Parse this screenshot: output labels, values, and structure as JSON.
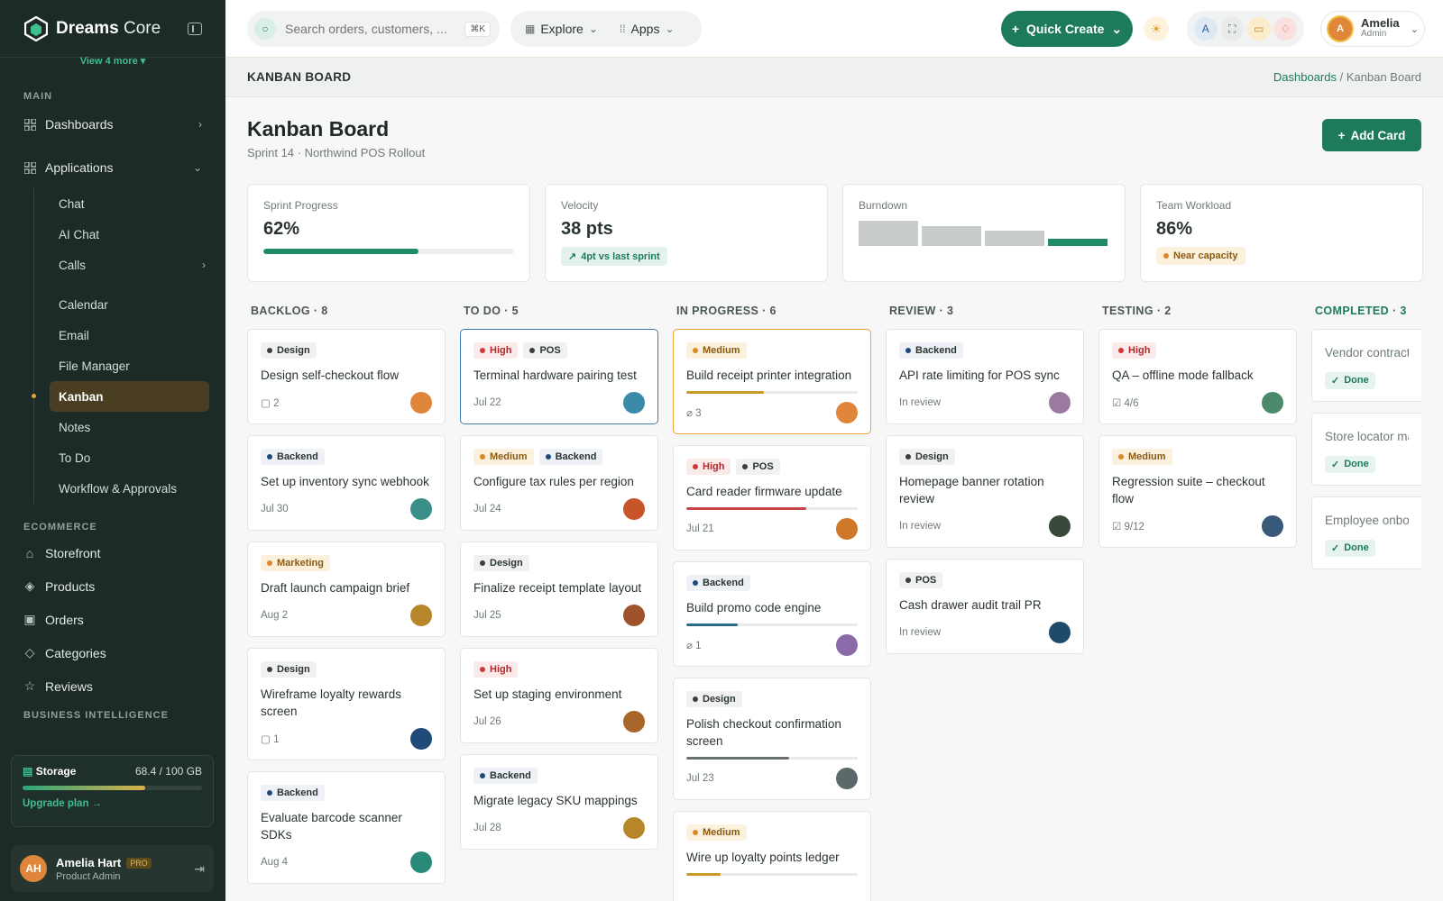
{
  "sidebar": {
    "brand_bold": "Dreams",
    "brand_light": "Core",
    "view_more": "View 4 more",
    "main_label": "MAIN",
    "dashboards": "Dashboards",
    "applications": "Applications",
    "apps": [
      "Chat",
      "AI Chat",
      "Calls",
      "Calendar",
      "Email",
      "File Manager",
      "Kanban",
      "Notes",
      "To Do",
      "Workflow & Approvals"
    ],
    "ecommerce_label": "ECOMMERCE",
    "ecommerce": [
      "Storefront",
      "Products",
      "Orders",
      "Categories",
      "Reviews"
    ],
    "bi_label": "BUSINESS INTELLIGENCE",
    "storage": {
      "label": "Storage",
      "value": "68.4 / 100 GB",
      "fraction": 0.684,
      "upgrade": "Upgrade plan →"
    },
    "user": {
      "name": "Amelia Hart",
      "badge": "PRO",
      "role": "Product Admin",
      "initials": "AH"
    }
  },
  "topbar": {
    "search_placeholder": "Search orders, customers, ...",
    "search_kbd": "⌘K",
    "explore": "Explore",
    "apps": "Apps",
    "quick_create": "Quick Create",
    "account_name": "Amelia",
    "account_role": "Admin",
    "account_initials": "A"
  },
  "page": {
    "header": "KANBAN BOARD",
    "breadcrumb_link": "Dashboards",
    "breadcrumb_sep": "/",
    "breadcrumb_current": "Kanban Board",
    "title": "Kanban Board",
    "subtitle": "Sprint 14 · Northwind POS Rollout",
    "add_card": "Add Card"
  },
  "stats": {
    "progress": {
      "label": "Sprint Progress",
      "value": "62%",
      "fraction": 0.62
    },
    "velocity": {
      "label": "Velocity",
      "value": "38 pts",
      "badge": "4pt vs last sprint"
    },
    "burndown": {
      "label": "Burndown",
      "bars": [
        28,
        22,
        17,
        8
      ]
    },
    "workload": {
      "label": "Team Workload",
      "value": "86%",
      "badge": "Near capacity"
    }
  },
  "colors": {
    "accent": "#1e7a5c",
    "Design": "#3a3f3d",
    "Backend": "#1f4a7a",
    "Marketing": "#d9892a",
    "POS": "#3a3f3d",
    "High": "#d0393b",
    "Medium": "#d9892a"
  },
  "columns": [
    {
      "title": "BACKLOG · 8",
      "cards": [
        {
          "tags": [
            "Design"
          ],
          "title": "Design self-checkout flow",
          "meta": "2",
          "meta_icon": "comment",
          "avatar": "#e0863a"
        },
        {
          "tags": [
            "Backend"
          ],
          "title": "Set up inventory sync webhook",
          "meta": "Jul 30",
          "avatar": "#3b8f8a"
        },
        {
          "tags": [
            "Marketing"
          ],
          "title": "Draft launch campaign brief",
          "meta": "Aug 2",
          "avatar": "#b8862a"
        },
        {
          "tags": [
            "Design"
          ],
          "title": "Wireframe loyalty rewards screen",
          "meta": "1",
          "meta_icon": "comment",
          "avatar": "#1f4a7a"
        },
        {
          "tags": [
            "Backend"
          ],
          "title": "Evaluate barcode scanner SDKs",
          "meta": "Aug 4",
          "avatar": "#2a8a7a"
        }
      ]
    },
    {
      "title": "TO DO · 5",
      "cards": [
        {
          "tags": [
            "High",
            "POS"
          ],
          "title": "Terminal hardware pairing test",
          "meta": "Jul 22",
          "avatar": "#3b8aa8",
          "sel": true
        },
        {
          "tags": [
            "Medium",
            "Backend"
          ],
          "title": "Configure tax rules per region",
          "meta": "Jul 24",
          "avatar": "#c8552a"
        },
        {
          "tags": [
            "Design"
          ],
          "title": "Finalize receipt template layout",
          "meta": "Jul 25",
          "avatar": "#a0522d"
        },
        {
          "tags": [
            "High"
          ],
          "title": "Set up staging environment",
          "meta": "Jul 26",
          "avatar": "#a8662a"
        },
        {
          "tags": [
            "Backend"
          ],
          "title": "Migrate legacy SKU mappings",
          "meta": "Jul 28",
          "avatar": "#b8862a"
        }
      ]
    },
    {
      "title": "IN PROGRESS · 6",
      "cards": [
        {
          "tags": [
            "Medium"
          ],
          "title": "Build receipt printer integration",
          "meta": "3",
          "meta_icon": "clip",
          "progress": 0.45,
          "pcolor": "#c89a2a",
          "avatar": "#e0863a",
          "hl": true
        },
        {
          "tags": [
            "High",
            "POS"
          ],
          "title": "Card reader firmware update",
          "meta": "Jul 21",
          "progress": 0.7,
          "pcolor": "#c8454a",
          "avatar": "#d0782a"
        },
        {
          "tags": [
            "Backend"
          ],
          "title": "Build promo code engine",
          "meta": "1",
          "meta_icon": "clip",
          "progress": 0.3,
          "pcolor": "#2a6a8a",
          "avatar": "#8a6aa8"
        },
        {
          "tags": [
            "Design"
          ],
          "title": "Polish checkout confirmation screen",
          "meta": "Jul 23",
          "progress": 0.6,
          "pcolor": "#6a706e",
          "avatar": "#5a6a6a"
        },
        {
          "tags": [
            "Medium"
          ],
          "title": "Wire up loyalty points ledger",
          "meta": "",
          "progress": 0.2,
          "pcolor": "#c89a2a",
          "avatar": ""
        }
      ]
    },
    {
      "title": "REVIEW · 3",
      "cards": [
        {
          "tags": [
            "Backend"
          ],
          "title": "API rate limiting for POS sync",
          "meta": "In review",
          "avatar": "#9a7aa0"
        },
        {
          "tags": [
            "Design"
          ],
          "title": "Homepage banner rotation review",
          "meta": "In review",
          "avatar": "#3a4a3a"
        },
        {
          "tags": [
            "POS"
          ],
          "title": "Cash drawer audit trail PR",
          "meta": "In review",
          "avatar": "#1f4a6a"
        }
      ]
    },
    {
      "title": "TESTING · 2",
      "cards": [
        {
          "tags": [
            "High"
          ],
          "title": "QA – offline mode fallback",
          "meta": "4/6",
          "meta_icon": "check",
          "avatar": "#4a8a6a"
        },
        {
          "tags": [
            "Medium"
          ],
          "title": "Regression suite – checkout flow",
          "meta": "9/12",
          "meta_icon": "check",
          "avatar": "#3a5a7a"
        }
      ]
    },
    {
      "title": "COMPLETED · 3",
      "cards": [
        {
          "title": "Vendor contract s",
          "done": "Done"
        },
        {
          "title": "Store locator map",
          "done": "Done"
        },
        {
          "title": "Employee onboar checklist",
          "done": "Done"
        }
      ]
    }
  ]
}
